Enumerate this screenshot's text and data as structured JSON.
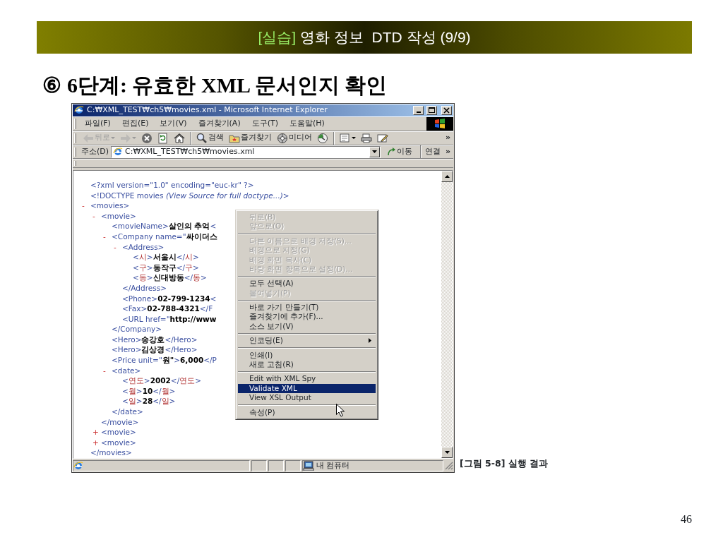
{
  "slide": {
    "banner": {
      "tag": "[실습]",
      "title": "영화 정보  DTD 작성 (9/9)"
    },
    "heading": {
      "marker": "⑥",
      "text": "6단계: 유효한 XML 문서인지 확인"
    },
    "caption": "[그림 5-8] 실행 결과",
    "page_number": "46"
  },
  "browser": {
    "title": "C:₩XML_TEST₩ch5₩movies.xml - Microsoft Internet Explorer",
    "menu": [
      "파일(F)",
      "편집(E)",
      "보기(V)",
      "즐겨찾기(A)",
      "도구(T)",
      "도움말(H)"
    ],
    "toolbar": [
      {
        "kind": "back",
        "label": "뒤로",
        "disabled": true,
        "dropdown": true
      },
      {
        "kind": "forward",
        "disabled": true,
        "dropdown": true
      },
      {
        "kind": "stop",
        "disabled": false,
        "dropdown": false
      },
      {
        "kind": "refresh",
        "disabled": false,
        "dropdown": false
      },
      {
        "kind": "home",
        "disabled": false,
        "dropdown": false
      },
      {
        "kind": "separator"
      },
      {
        "kind": "search",
        "label": "검색",
        "disabled": false,
        "dropdown": false
      },
      {
        "kind": "favorites",
        "label": "즐겨찾기",
        "disabled": false,
        "dropdown": false
      },
      {
        "kind": "media",
        "label": "미디어",
        "disabled": false,
        "dropdown": false
      },
      {
        "kind": "history",
        "disabled": false,
        "dropdown": false
      },
      {
        "kind": "separator"
      },
      {
        "kind": "mail",
        "disabled": false,
        "dropdown": true
      },
      {
        "kind": "print",
        "disabled": false,
        "dropdown": false
      },
      {
        "kind": "edit",
        "disabled": false,
        "dropdown": false
      }
    ],
    "toolbar_more": "»",
    "address": {
      "label": "주소(D)",
      "value": "C:₩XML_TEST₩ch5₩movies.xml",
      "go": "이동",
      "links": "연결",
      "links_more": "»"
    },
    "document": {
      "prolog": [
        [
          {
            "kind": "markup",
            "text": "<?xml version=\"1.0\" encoding=\"euc-kr\" ?>"
          }
        ],
        [
          {
            "kind": "markup",
            "text": "<!DOCTYPE movies "
          },
          {
            "kind": "note",
            "text": "(View Source for full doctype...)"
          },
          {
            "kind": "markup",
            "text": ">"
          }
        ]
      ],
      "tree": [
        {
          "toggle": "-",
          "open": [
            {
              "kind": "markup",
              "text": "<movies>"
            }
          ],
          "children": [
            {
              "toggle": "-",
              "open": [
                {
                  "kind": "markup",
                  "text": "<movie>"
                }
              ],
              "children": [
                {
                  "parts": [
                    {
                      "kind": "markup",
                      "text": "<movieName>"
                    },
                    {
                      "kind": "value",
                      "text": "살인의 추억"
                    },
                    {
                      "kind": "markup",
                      "text": "<"
                    }
                  ]
                },
                {
                  "toggle": "-",
                  "open": [
                    {
                      "kind": "markup",
                      "text": "<Company name=\""
                    },
                    {
                      "kind": "value",
                      "text": "싸이더스"
                    }
                  ],
                  "children": [
                    {
                      "toggle": "-",
                      "open": [
                        {
                          "kind": "markup",
                          "text": "<Address>"
                        }
                      ],
                      "children": [
                        {
                          "parts": [
                            {
                              "kind": "markup",
                              "text": "<"
                            },
                            {
                              "kind": "name",
                              "text": "시"
                            },
                            {
                              "kind": "markup",
                              "text": ">"
                            },
                            {
                              "kind": "value",
                              "text": "서울시"
                            },
                            {
                              "kind": "markup",
                              "text": "</"
                            },
                            {
                              "kind": "name",
                              "text": "시"
                            },
                            {
                              "kind": "markup",
                              "text": ">"
                            }
                          ]
                        },
                        {
                          "parts": [
                            {
                              "kind": "markup",
                              "text": "<"
                            },
                            {
                              "kind": "name",
                              "text": "구"
                            },
                            {
                              "kind": "markup",
                              "text": ">"
                            },
                            {
                              "kind": "value",
                              "text": "동작구"
                            },
                            {
                              "kind": "markup",
                              "text": "</"
                            },
                            {
                              "kind": "name",
                              "text": "구"
                            },
                            {
                              "kind": "markup",
                              "text": ">"
                            }
                          ]
                        },
                        {
                          "parts": [
                            {
                              "kind": "markup",
                              "text": "<"
                            },
                            {
                              "kind": "name",
                              "text": "동"
                            },
                            {
                              "kind": "markup",
                              "text": ">"
                            },
                            {
                              "kind": "value",
                              "text": "신대방동"
                            },
                            {
                              "kind": "markup",
                              "text": "</"
                            },
                            {
                              "kind": "name",
                              "text": "동"
                            },
                            {
                              "kind": "markup",
                              "text": ">"
                            }
                          ]
                        }
                      ],
                      "close": [
                        {
                          "kind": "markup",
                          "text": "</Address>"
                        }
                      ]
                    },
                    {
                      "parts": [
                        {
                          "kind": "markup",
                          "text": "<Phone>"
                        },
                        {
                          "kind": "value",
                          "text": "02-799-1234"
                        },
                        {
                          "kind": "markup",
                          "text": "<"
                        }
                      ]
                    },
                    {
                      "parts": [
                        {
                          "kind": "markup",
                          "text": "<Fax>"
                        },
                        {
                          "kind": "value",
                          "text": "02-788-4321"
                        },
                        {
                          "kind": "markup",
                          "text": "</F"
                        }
                      ]
                    },
                    {
                      "parts": [
                        {
                          "kind": "markup",
                          "text": "<URL href=\""
                        },
                        {
                          "kind": "value",
                          "text": "http://www"
                        }
                      ]
                    }
                  ],
                  "close": [
                    {
                      "kind": "markup",
                      "text": "</Company>"
                    }
                  ]
                },
                {
                  "parts": [
                    {
                      "kind": "markup",
                      "text": "<Hero>"
                    },
                    {
                      "kind": "value",
                      "text": "송강호"
                    },
                    {
                      "kind": "markup",
                      "text": "</Hero>"
                    }
                  ]
                },
                {
                  "parts": [
                    {
                      "kind": "markup",
                      "text": "<Hero>"
                    },
                    {
                      "kind": "value",
                      "text": "김상경"
                    },
                    {
                      "kind": "markup",
                      "text": "</Hero>"
                    }
                  ]
                },
                {
                  "parts": [
                    {
                      "kind": "markup",
                      "text": "<Price unit=\""
                    },
                    {
                      "kind": "value",
                      "text": "원\""
                    },
                    {
                      "kind": "markup",
                      "text": ">"
                    },
                    {
                      "kind": "value",
                      "text": "6,000"
                    },
                    {
                      "kind": "markup",
                      "text": "</P"
                    }
                  ]
                },
                {
                  "toggle": "-",
                  "open": [
                    {
                      "kind": "markup",
                      "text": "<date>"
                    }
                  ],
                  "children": [
                    {
                      "parts": [
                        {
                          "kind": "markup",
                          "text": "<"
                        },
                        {
                          "kind": "name",
                          "text": "연도"
                        },
                        {
                          "kind": "markup",
                          "text": ">"
                        },
                        {
                          "kind": "value",
                          "text": "2002"
                        },
                        {
                          "kind": "markup",
                          "text": "</"
                        },
                        {
                          "kind": "name",
                          "text": "연도"
                        },
                        {
                          "kind": "markup",
                          "text": ">"
                        }
                      ]
                    },
                    {
                      "parts": [
                        {
                          "kind": "markup",
                          "text": "<"
                        },
                        {
                          "kind": "name",
                          "text": "월"
                        },
                        {
                          "kind": "markup",
                          "text": ">"
                        },
                        {
                          "kind": "value",
                          "text": "10"
                        },
                        {
                          "kind": "markup",
                          "text": "</"
                        },
                        {
                          "kind": "name",
                          "text": "월"
                        },
                        {
                          "kind": "markup",
                          "text": ">"
                        }
                      ]
                    },
                    {
                      "parts": [
                        {
                          "kind": "markup",
                          "text": "<"
                        },
                        {
                          "kind": "name",
                          "text": "일"
                        },
                        {
                          "kind": "markup",
                          "text": ">"
                        },
                        {
                          "kind": "value",
                          "text": "28"
                        },
                        {
                          "kind": "markup",
                          "text": "</"
                        },
                        {
                          "kind": "name",
                          "text": "일"
                        },
                        {
                          "kind": "markup",
                          "text": ">"
                        }
                      ]
                    }
                  ],
                  "close": [
                    {
                      "kind": "markup",
                      "text": "</date>"
                    }
                  ]
                }
              ],
              "close": [
                {
                  "kind": "markup",
                  "text": "</movie>"
                }
              ]
            },
            {
              "toggle": "+",
              "open": [
                {
                  "kind": "markup",
                  "text": "<movie>"
                }
              ]
            },
            {
              "toggle": "+",
              "open": [
                {
                  "kind": "markup",
                  "text": "<movie>"
                }
              ]
            }
          ],
          "close": [
            {
              "kind": "markup",
              "text": "</movies>"
            }
          ]
        }
      ]
    },
    "context_menu": [
      {
        "kind": "item",
        "label": "뒤로(B)",
        "disabled": true,
        "selected": false,
        "submenu": false
      },
      {
        "kind": "item",
        "label": "앞으로(O)",
        "disabled": true,
        "selected": false,
        "submenu": false
      },
      {
        "kind": "separator"
      },
      {
        "kind": "item",
        "label": "다른 이름으로 배경 저장(S)...",
        "disabled": true,
        "selected": false,
        "submenu": false
      },
      {
        "kind": "item",
        "label": "배경으로 지정(G)",
        "disabled": true,
        "selected": false,
        "submenu": false
      },
      {
        "kind": "item",
        "label": "배경 화면 복사(C)",
        "disabled": true,
        "selected": false,
        "submenu": false
      },
      {
        "kind": "item",
        "label": "바탕 화면 항목으로 설정(D)...",
        "disabled": true,
        "selected": false,
        "submenu": false
      },
      {
        "kind": "separator"
      },
      {
        "kind": "item",
        "label": "모두 선택(A)",
        "disabled": false,
        "selected": false,
        "submenu": false
      },
      {
        "kind": "item",
        "label": "붙여넣기(P)",
        "disabled": true,
        "selected": false,
        "submenu": false
      },
      {
        "kind": "separator"
      },
      {
        "kind": "item",
        "label": "바로 가기 만들기(T)",
        "disabled": false,
        "selected": false,
        "submenu": false
      },
      {
        "kind": "item",
        "label": "즐겨찾기에 추가(F)...",
        "disabled": false,
        "selected": false,
        "submenu": false
      },
      {
        "kind": "item",
        "label": "소스 보기(V)",
        "disabled": false,
        "selected": false,
        "submenu": false
      },
      {
        "kind": "separator"
      },
      {
        "kind": "item",
        "label": "인코딩(E)",
        "disabled": false,
        "selected": false,
        "submenu": true
      },
      {
        "kind": "separator"
      },
      {
        "kind": "item",
        "label": "인쇄(I)",
        "disabled": false,
        "selected": false,
        "submenu": false
      },
      {
        "kind": "item",
        "label": "새로 고침(R)",
        "disabled": false,
        "selected": false,
        "submenu": false
      },
      {
        "kind": "separator"
      },
      {
        "kind": "item",
        "label": "Edit with XML Spy",
        "disabled": false,
        "selected": false,
        "submenu": false
      },
      {
        "kind": "item",
        "label": "Validate XML",
        "disabled": false,
        "selected": true,
        "submenu": false
      },
      {
        "kind": "item",
        "label": "View XSL Output",
        "disabled": false,
        "selected": false,
        "submenu": false
      },
      {
        "kind": "separator"
      },
      {
        "kind": "item",
        "label": "속성(P)",
        "disabled": false,
        "selected": false,
        "submenu": false
      }
    ],
    "status": {
      "zone": "내 컴퓨터"
    }
  }
}
